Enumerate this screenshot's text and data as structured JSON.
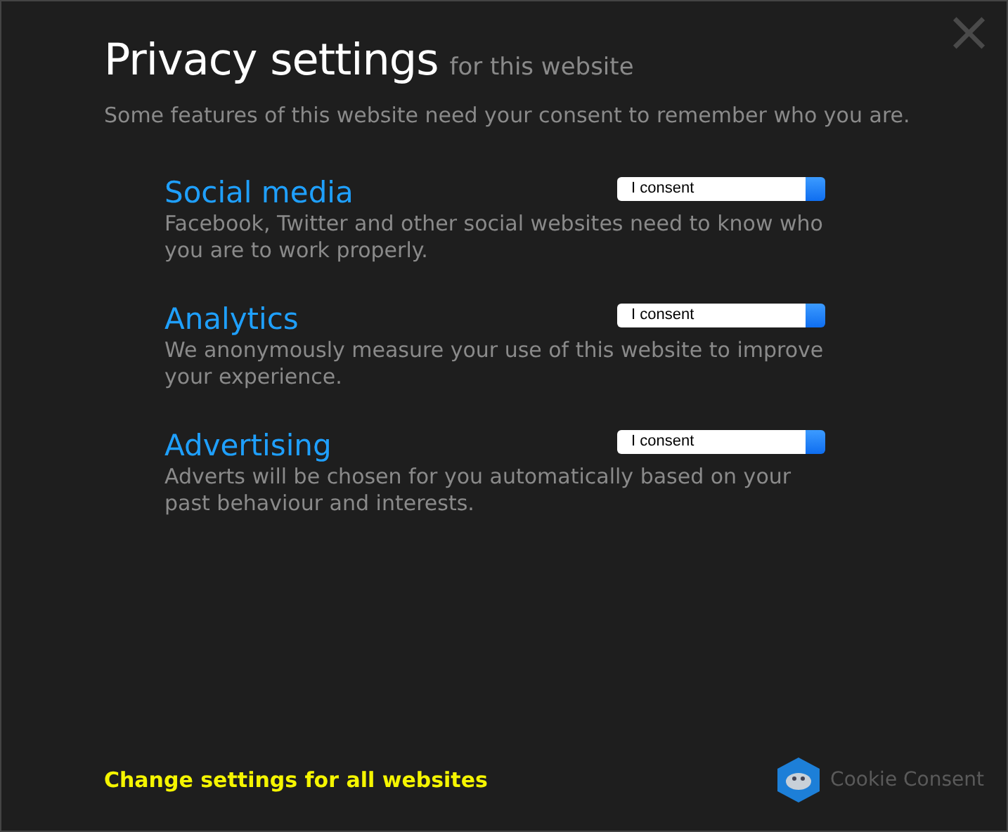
{
  "dialog": {
    "title": "Privacy settings",
    "subtitle": "for this website",
    "intro": "Some features of this website need your consent to remember who you are.",
    "close": "×"
  },
  "sections": [
    {
      "heading": "Social media",
      "description": "Facebook, Twitter and other social websites need to know who you are to work properly.",
      "select": {
        "value": "I consent"
      }
    },
    {
      "heading": "Analytics",
      "description": "We anonymously measure your use of this website to improve your experience.",
      "select": {
        "value": "I consent"
      }
    },
    {
      "heading": "Advertising",
      "description": "Adverts will be chosen for you automatically based on your past behaviour and interests.",
      "select": {
        "value": "I consent"
      }
    }
  ],
  "footer": {
    "link": "Change settings for all websites",
    "brand": "Cookie Consent"
  }
}
